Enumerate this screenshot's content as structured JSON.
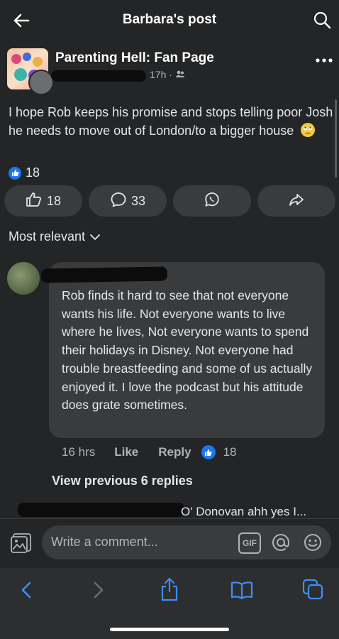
{
  "header": {
    "title": "Barbara's post"
  },
  "post": {
    "group_name": "Parenting Hell: Fan Page",
    "time": "17h",
    "separator": "·",
    "text": "I hope Rob keeps his promise and stops telling poor Josh he needs to move out of London/to a bigger house",
    "reaction_count": "18"
  },
  "actions": {
    "like_count": "18",
    "comment_count": "33"
  },
  "comments": {
    "sort_label": "Most relevant",
    "items": [
      {
        "text": "Rob finds it hard to see that not everyone wants his life. Not everyone wants to live where he lives, Not everyone wants to spend their holidays in Disney. Not everyone had trouble breastfeeding and some of us actually enjoyed it. I love the podcast but his attitude does grate sometimes.",
        "time": "16 hrs",
        "like_label": "Like",
        "reply_label": "Reply",
        "reaction_count": "18"
      }
    ],
    "view_previous": "View previous 6 replies",
    "reply_preview": "O' Donovan ahh yes I..."
  },
  "composer": {
    "placeholder": "Write a comment...",
    "gif_label": "GIF"
  },
  "colors": {
    "accent": "#1877f2",
    "background": "#242526",
    "surface": "#3a3b3c"
  }
}
